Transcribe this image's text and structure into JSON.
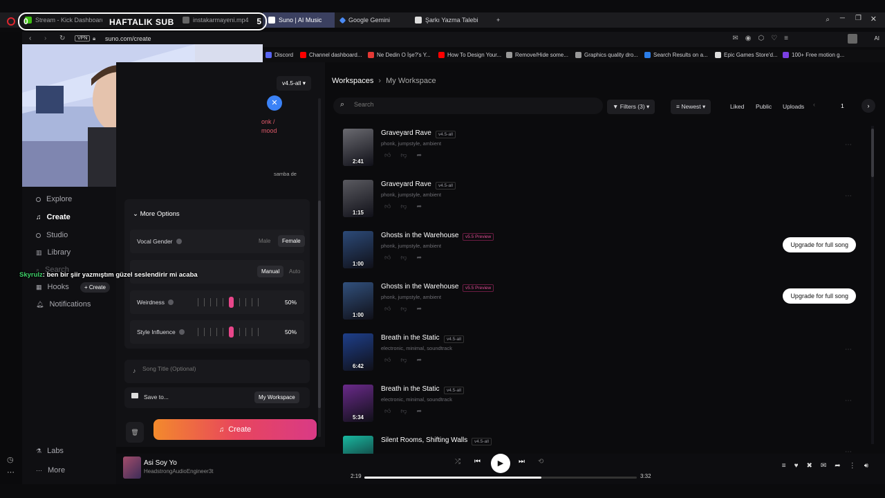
{
  "overlay": {
    "left_counter": "0",
    "badge": "HAFTALIK SUB",
    "right_counter": "5"
  },
  "chat": {
    "user": "Skyrulz",
    "message": ": ben bir şiir yazmıştım güzel seslendirir mi acaba"
  },
  "browser": {
    "tabs": [
      {
        "label": "Stream - Kick Dashboard",
        "color": "#53fc18"
      },
      {
        "label": "instakarmayeni.mp4",
        "color": "#888888"
      },
      {
        "label": "Suno | AI Music",
        "color": "#ffffff"
      },
      {
        "label": "Google Gemini",
        "color": "#4a8af4"
      },
      {
        "label": "Şarkı Yazma Talebi",
        "color": "#dddddd"
      }
    ],
    "new_tab": "+",
    "vpn_badge": "VPN",
    "url": "suno.com/create",
    "ext_label": "AI",
    "bookmarks": [
      {
        "label": "Discord",
        "color": "#5865f2"
      },
      {
        "label": "Channel dashboard...",
        "color": "#ff0000"
      },
      {
        "label": "Ne Dedin O İşe?'s Y...",
        "color": "#e53935"
      },
      {
        "label": "How To Design Your...",
        "color": "#ff0000"
      },
      {
        "label": "Remove/Hide some...",
        "color": "#999999"
      },
      {
        "label": "Graphics quality dro...",
        "color": "#999999"
      },
      {
        "label": "Search Results on a...",
        "color": "#2b7de9"
      },
      {
        "label": "Epic Games Store'd...",
        "color": "#dddddd"
      },
      {
        "label": "100+ Free motion g...",
        "color": "#7b3fe4"
      }
    ]
  },
  "sidebar": {
    "items": [
      {
        "label": "Explore",
        "icon": "compass-icon"
      },
      {
        "label": "Create",
        "icon": "music-note-icon",
        "active": true
      },
      {
        "label": "Studio",
        "icon": "studio-icon"
      },
      {
        "label": "Library",
        "icon": "library-icon"
      },
      {
        "label": "Search",
        "icon": "search-icon"
      },
      {
        "label": "Hooks",
        "icon": "hooks-icon"
      },
      {
        "label": "Notifications",
        "icon": "bell-icon"
      }
    ],
    "hooks_create": "+ Create",
    "labs": "Labs",
    "more": "More"
  },
  "create_panel": {
    "model": "v4.5-all",
    "style_fragment": "onk /\nmood",
    "style_chip": "samba de",
    "more_options": "More Options",
    "vocal_gender": {
      "label": "Vocal Gender",
      "options": [
        "Male",
        "Female"
      ],
      "selected": "Female"
    },
    "lyrics_mode": {
      "options": [
        "Manual",
        "Auto"
      ],
      "selected": "Manual"
    },
    "weirdness": {
      "label": "Weirdness",
      "value": "50%",
      "level": 0.5
    },
    "style_influence": {
      "label": "Style Influence",
      "value": "50%",
      "level": 0.5
    },
    "song_title_placeholder": "Song Title (Optional)",
    "save_to": "Save to...",
    "workspace": "My Workspace",
    "create_button": "Create"
  },
  "main": {
    "breadcrumb": {
      "root": "Workspaces",
      "current": "My Workspace"
    },
    "search_placeholder": "Search",
    "filters": "Filters (3)",
    "sort": "Newest",
    "liked": "Liked",
    "public": "Public",
    "uploads": "Uploads",
    "page": "1",
    "upgrade_label": "Upgrade for full song",
    "songs": [
      {
        "title": "Graveyard Rave",
        "version": "v4.5-all",
        "preview": false,
        "tags": "phonk, jumpstyle, ambient",
        "duration": "2:41",
        "upgrade": false,
        "art": "#6a6a70"
      },
      {
        "title": "Graveyard Rave",
        "version": "v4.5-all",
        "preview": false,
        "tags": "phonk, jumpstyle, ambient",
        "duration": "1:15",
        "upgrade": false,
        "art": "#5a5a60"
      },
      {
        "title": "Ghosts in the Warehouse",
        "version": "v5.5 Preview",
        "preview": true,
        "tags": "phonk, jumpstyle, ambient",
        "duration": "1:00",
        "upgrade": true,
        "art": "#2c4a78"
      },
      {
        "title": "Ghosts in the Warehouse",
        "version": "v5.5 Preview",
        "preview": true,
        "tags": "phonk, jumpstyle, ambient",
        "duration": "1:00",
        "upgrade": true,
        "art": "#31507c"
      },
      {
        "title": "Breath in the Static",
        "version": "v4.5-all",
        "preview": false,
        "tags": "electronic, minimal, soundtrack",
        "duration": "6:42",
        "upgrade": false,
        "art": "#1e3f8a"
      },
      {
        "title": "Breath in the Static",
        "version": "v4.5-all",
        "preview": false,
        "tags": "electronic, minimal, soundtrack",
        "duration": "5:34",
        "upgrade": false,
        "art": "#6a2a8a"
      },
      {
        "title": "Silent Rooms, Shifting Walls",
        "version": "v4.5-all",
        "preview": false,
        "tags": "",
        "duration": "",
        "upgrade": false,
        "art": "#19b8a0"
      }
    ]
  },
  "player": {
    "title": "Asi Soy Yo",
    "artist": "HeadstrongAudioEngineer3t",
    "elapsed": "2:19",
    "total": "3:32",
    "progress": 0.65
  }
}
